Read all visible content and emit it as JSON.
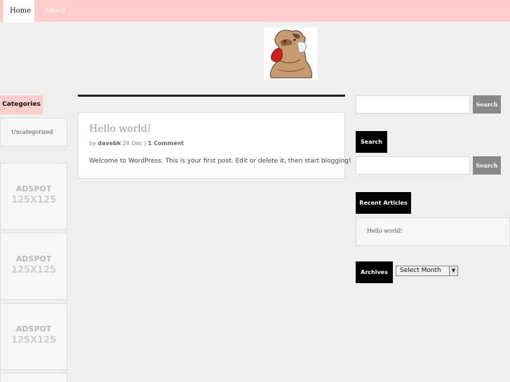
{
  "nav": {
    "items": [
      {
        "label": "Home"
      },
      {
        "label": "About"
      }
    ]
  },
  "sidebar_left": {
    "categories_title": "Categories",
    "categories": [
      {
        "label": "Uncategorized"
      }
    ],
    "ads": [
      {
        "line1": "ADSPOT",
        "line2": "125X125"
      },
      {
        "line1": "ADSPOT",
        "line2": "125X125"
      },
      {
        "line1": "ADSPOT",
        "line2": "125X125"
      }
    ]
  },
  "post": {
    "title": "Hello world!",
    "meta_prefix": "by",
    "author": "davebk",
    "date": "28 Dec",
    "separator": "|",
    "comments": "1 Comment",
    "body": "Welcome to WordPress. This is your first post. Edit or delete it, then start blogging!"
  },
  "sidebar_right": {
    "search_button": "Search",
    "search_title": "Search",
    "search_button_2": "Search",
    "recent_title": "Recent Articles",
    "recent": [
      {
        "label": "Hello world!"
      }
    ],
    "archives_title": "Archives",
    "archives_select": "Select Month"
  },
  "colors": {
    "nav_bg": "#ffcccc",
    "widget_title_bg": "#000000",
    "button_bg": "#888888"
  },
  "icons": {
    "logo": "cartoon-bear-logo",
    "dropdown": "chevron-down-icon"
  }
}
